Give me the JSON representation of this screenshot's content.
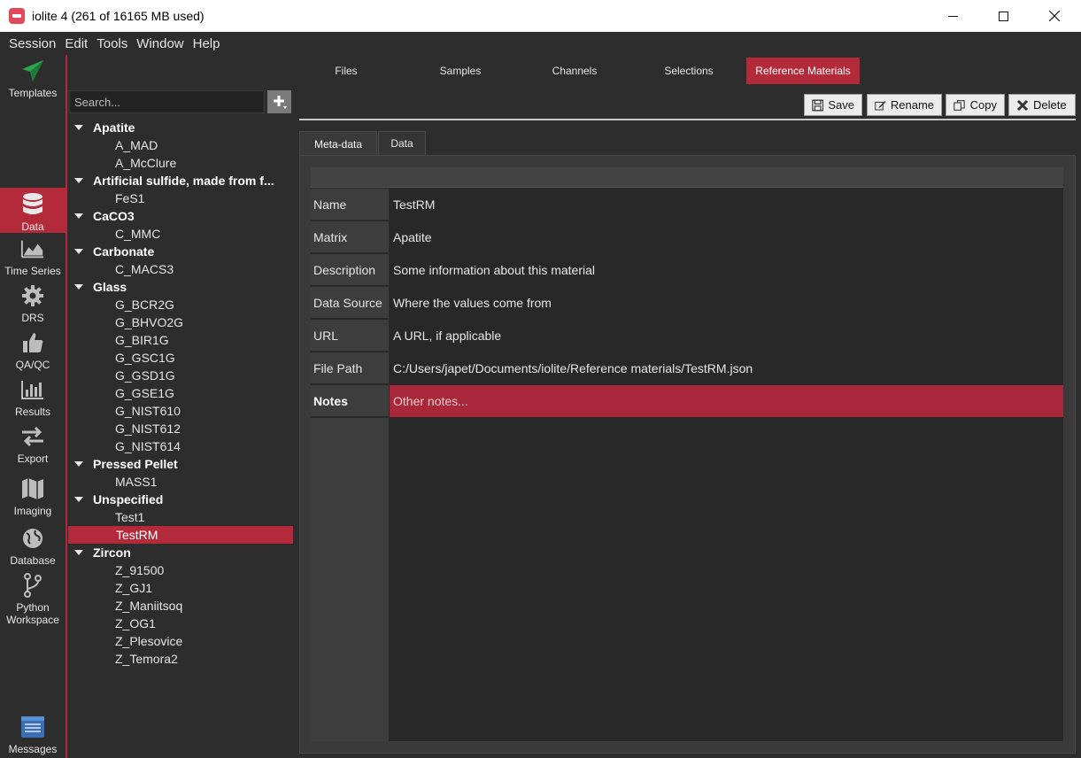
{
  "window": {
    "title": "iolite 4 (261 of 16165 MB used)"
  },
  "menu": [
    "Session",
    "Edit",
    "Tools",
    "Window",
    "Help"
  ],
  "nav": [
    {
      "label": "Templates",
      "icon": "paper-plane-icon"
    },
    {
      "label": "Data",
      "icon": "database-icon",
      "active": true
    },
    {
      "label": "Time Series",
      "icon": "area-chart-icon"
    },
    {
      "label": "DRS",
      "icon": "gear-icon"
    },
    {
      "label": "QA/QC",
      "icon": "thumbs-up-icon"
    },
    {
      "label": "Results",
      "icon": "bar-chart-icon"
    },
    {
      "label": "Export",
      "icon": "arrows-exchange-icon"
    },
    {
      "label": "Imaging",
      "icon": "map-icon"
    },
    {
      "label": "Database",
      "icon": "globe-icon"
    },
    {
      "label": "Python Workspace",
      "icon": "branch-icon"
    },
    {
      "label": "Messages",
      "icon": "messages-icon"
    }
  ],
  "top_tabs": [
    "Files",
    "Samples",
    "Channels",
    "Selections",
    "Reference Materials"
  ],
  "active_top_tab": "Reference Materials",
  "search": {
    "placeholder": "Search...",
    "value": ""
  },
  "tree": [
    {
      "group": "Apatite",
      "items": [
        "A_MAD",
        "A_McClure"
      ]
    },
    {
      "group": "Artificial sulfide, made from f...",
      "items": [
        "FeS1"
      ]
    },
    {
      "group": "CaCO3",
      "items": [
        "C_MMC"
      ]
    },
    {
      "group": "Carbonate",
      "items": [
        "C_MACS3"
      ]
    },
    {
      "group": "Glass",
      "items": [
        "G_BCR2G",
        "G_BHVO2G",
        "G_BIR1G",
        "G_GSC1G",
        "G_GSD1G",
        "G_GSE1G",
        "G_NIST610",
        "G_NIST612",
        "G_NIST614"
      ]
    },
    {
      "group": "Pressed Pellet",
      "items": [
        "MASS1"
      ]
    },
    {
      "group": "Unspecified",
      "items": [
        "Test1",
        "TestRM"
      ]
    },
    {
      "group": "Zircon",
      "items": [
        "Z_91500",
        "Z_GJ1",
        "Z_Maniitsoq",
        "Z_OG1",
        "Z_Plesovice",
        "Z_Temora2"
      ]
    }
  ],
  "selected_item": "TestRM",
  "toolbar": {
    "save": "Save",
    "rename": "Rename",
    "copy": "Copy",
    "delete": "Delete"
  },
  "sub_tabs": [
    "Meta-data",
    "Data"
  ],
  "active_sub_tab": "Meta-data",
  "metadata": [
    {
      "label": "Name",
      "value": "TestRM"
    },
    {
      "label": "Matrix",
      "value": "Apatite"
    },
    {
      "label": "Description",
      "value": "Some information about this material"
    },
    {
      "label": "Data Source",
      "value": "Where the values come from"
    },
    {
      "label": "URL",
      "value": "A URL, if applicable"
    },
    {
      "label": "File Path",
      "value": "C:/Users/japet/Documents/iolite/Reference materials/TestRM.json"
    },
    {
      "label": "Notes",
      "value": "Other notes...",
      "selected": true
    }
  ],
  "colors": {
    "accent": "#b32a3a",
    "background": "#2d2d2d",
    "panel": "#282828"
  }
}
